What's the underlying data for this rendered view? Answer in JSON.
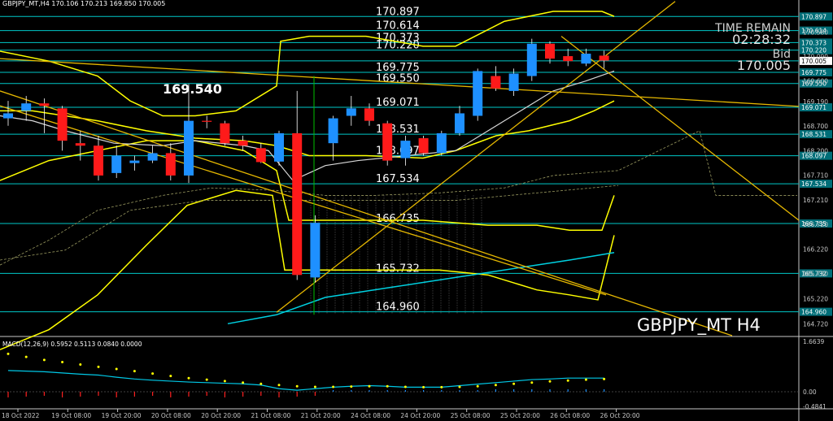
{
  "header": {
    "symbol_info": "GBPJPY_MT,H4  170.106 170.213 169.850 170.005"
  },
  "top_right": {
    "time_remain_label": "TIME REMAIN",
    "time_remain_value": "02:28:32",
    "bid_label": "Bid",
    "bid_value": "170.005"
  },
  "watermark": "GBPJPY_MT H4",
  "macd_header": "MACD(12,26,9) 0.5952 0.5113 0.0840 0.0000",
  "max_label": "169.540",
  "colors": {
    "background": "#000000",
    "bull_candle": "#1e90ff",
    "bear_candle": "#ff1a1a",
    "level_line": "#00c8c8",
    "yellow_line": "#ffff00",
    "trend_line": "#e6b800",
    "ma_cyan": "#00d0e0",
    "ma_white": "#d8d8d8",
    "macd_line": "#00c8e6",
    "macd_signal": "#ffff00"
  },
  "chart_data": {
    "type": "candlestick",
    "symbol": "GBPJPY_MT",
    "timeframe": "H4",
    "ylim": [
      164.48,
      171.0
    ],
    "x_tick_labels": [
      "18 Oct 2022",
      "19 Oct 08:00",
      "19 Oct 20:00",
      "20 Oct 08:00",
      "20 Oct 20:00",
      "21 Oct 08:00",
      "21 Oct 20:00",
      "24 Oct 08:00",
      "24 Oct 20:00",
      "25 Oct 08:00",
      "25 Oct 20:00",
      "26 Oct 08:00",
      "26 Oct 20:00"
    ],
    "y_tick_labels": [
      "170.580",
      "170.090",
      "169.600",
      "169.190",
      "168.700",
      "168.200",
      "167.710",
      "167.210",
      "166.720",
      "166.220",
      "165.730",
      "165.220",
      "164.720"
    ],
    "candles": [
      {
        "o": 168.85,
        "h": 169.2,
        "l": 168.7,
        "c": 168.95
      },
      {
        "o": 169.0,
        "h": 169.3,
        "l": 168.8,
        "c": 169.15
      },
      {
        "o": 169.15,
        "h": 169.25,
        "l": 168.55,
        "c": 169.1
      },
      {
        "o": 169.05,
        "h": 169.1,
        "l": 168.2,
        "c": 168.4
      },
      {
        "o": 168.35,
        "h": 168.6,
        "l": 168.0,
        "c": 168.3
      },
      {
        "o": 168.3,
        "h": 168.5,
        "l": 167.6,
        "c": 167.7
      },
      {
        "o": 167.75,
        "h": 168.3,
        "l": 167.65,
        "c": 168.1
      },
      {
        "o": 167.95,
        "h": 168.1,
        "l": 167.8,
        "c": 168.0
      },
      {
        "o": 168.0,
        "h": 168.3,
        "l": 167.95,
        "c": 168.15
      },
      {
        "o": 168.15,
        "h": 168.35,
        "l": 167.6,
        "c": 167.7
      },
      {
        "o": 167.7,
        "h": 169.54,
        "l": 167.55,
        "c": 168.8
      },
      {
        "o": 168.8,
        "h": 168.9,
        "l": 168.65,
        "c": 168.78
      },
      {
        "o": 168.75,
        "h": 168.8,
        "l": 168.3,
        "c": 168.35
      },
      {
        "o": 168.4,
        "h": 168.5,
        "l": 168.2,
        "c": 168.3
      },
      {
        "o": 168.25,
        "h": 168.35,
        "l": 167.95,
        "c": 167.97
      },
      {
        "o": 167.98,
        "h": 168.6,
        "l": 167.9,
        "c": 168.55
      },
      {
        "o": 168.55,
        "h": 169.4,
        "l": 165.6,
        "c": 165.7
      },
      {
        "o": 165.65,
        "h": 166.9,
        "l": 165.55,
        "c": 166.75
      },
      {
        "o": 168.35,
        "h": 168.9,
        "l": 168.0,
        "c": 168.85
      },
      {
        "o": 168.9,
        "h": 169.3,
        "l": 168.7,
        "c": 169.05
      },
      {
        "o": 169.05,
        "h": 169.15,
        "l": 168.7,
        "c": 168.8
      },
      {
        "o": 168.75,
        "h": 168.8,
        "l": 167.9,
        "c": 168.0
      },
      {
        "o": 168.05,
        "h": 168.5,
        "l": 167.9,
        "c": 168.4
      },
      {
        "o": 168.45,
        "h": 168.5,
        "l": 168.1,
        "c": 168.15
      },
      {
        "o": 168.15,
        "h": 168.6,
        "l": 168.1,
        "c": 168.55
      },
      {
        "o": 168.55,
        "h": 169.1,
        "l": 168.5,
        "c": 168.95
      },
      {
        "o": 168.9,
        "h": 169.85,
        "l": 168.8,
        "c": 169.8
      },
      {
        "o": 169.7,
        "h": 169.9,
        "l": 169.4,
        "c": 169.45
      },
      {
        "o": 169.4,
        "h": 169.85,
        "l": 169.3,
        "c": 169.75
      },
      {
        "o": 169.7,
        "h": 170.45,
        "l": 169.6,
        "c": 170.35
      },
      {
        "o": 170.35,
        "h": 170.4,
        "l": 169.95,
        "c": 170.05
      },
      {
        "o": 170.1,
        "h": 170.25,
        "l": 169.9,
        "c": 170.0
      },
      {
        "o": 169.95,
        "h": 170.25,
        "l": 169.9,
        "c": 170.15
      },
      {
        "o": 170.11,
        "h": 170.21,
        "l": 169.85,
        "c": 170.01
      }
    ],
    "horizontal_levels": [
      {
        "value": 170.897,
        "label": "170.897"
      },
      {
        "value": 170.614,
        "label": "170.614"
      },
      {
        "value": 170.373,
        "label": "170.373"
      },
      {
        "value": 170.22,
        "label": "170.220"
      },
      {
        "value": 170.005,
        "label": "170.005"
      },
      {
        "value": 169.775,
        "label": "169.775"
      },
      {
        "value": 169.55,
        "label": "169.550"
      },
      {
        "value": 169.071,
        "label": "169.071"
      },
      {
        "value": 168.531,
        "label": "168.531"
      },
      {
        "value": 168.097,
        "label": "168.097"
      },
      {
        "value": 167.534,
        "label": "167.534"
      },
      {
        "value": 166.735,
        "label": "166.735"
      },
      {
        "value": 165.732,
        "label": "165.732"
      },
      {
        "value": 164.96,
        "label": "164.960"
      }
    ],
    "macd": {
      "name": "MACD(12,26,9)",
      "values": [
        0.5952,
        0.5113,
        0.084,
        0.0
      ],
      "y_tick_labels": [
        "1.6639",
        "0.00",
        "-0.4841"
      ],
      "ylim": [
        -0.4841,
        1.6639
      ]
    }
  }
}
